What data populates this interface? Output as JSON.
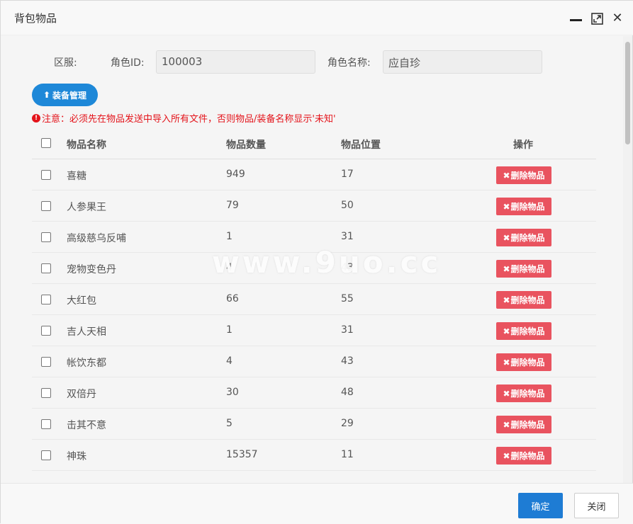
{
  "window": {
    "title": "背包物品"
  },
  "form": {
    "server_label": "区服:",
    "role_id_label": "角色ID:",
    "role_id_value": "100003",
    "role_name_label": "角色名称:",
    "role_name_value": "应自珍"
  },
  "equip_button": "装备管理",
  "notice": "注意：必须先在物品发送中导入所有文件，否则物品/装备名称显示'未知'",
  "table": {
    "headers": {
      "name": "物品名称",
      "qty": "物品数量",
      "pos": "物品位置",
      "op": "操作"
    },
    "delete_label": "删除物品",
    "rows": [
      {
        "name": "喜糖",
        "qty": "949",
        "pos": "17"
      },
      {
        "name": "人参果王",
        "qty": "79",
        "pos": "50"
      },
      {
        "name": "高级慈乌反哺",
        "qty": "1",
        "pos": "31"
      },
      {
        "name": "宠物变色丹",
        "qty": "4",
        "pos": "43"
      },
      {
        "name": "大红包",
        "qty": "66",
        "pos": "55"
      },
      {
        "name": "吉人天相",
        "qty": "1",
        "pos": "31"
      },
      {
        "name": "帐饮东都",
        "qty": "4",
        "pos": "43"
      },
      {
        "name": "双倍丹",
        "qty": "30",
        "pos": "48"
      },
      {
        "name": "击其不意",
        "qty": "5",
        "pos": "29"
      },
      {
        "name": "神珠",
        "qty": "15357",
        "pos": "11"
      }
    ]
  },
  "footer": {
    "ok": "确定",
    "close": "关闭"
  },
  "watermark": "www.9uo.cc",
  "colors": {
    "primary": "#1e88d8",
    "danger": "#e9535f",
    "notice": "#e4141b"
  }
}
